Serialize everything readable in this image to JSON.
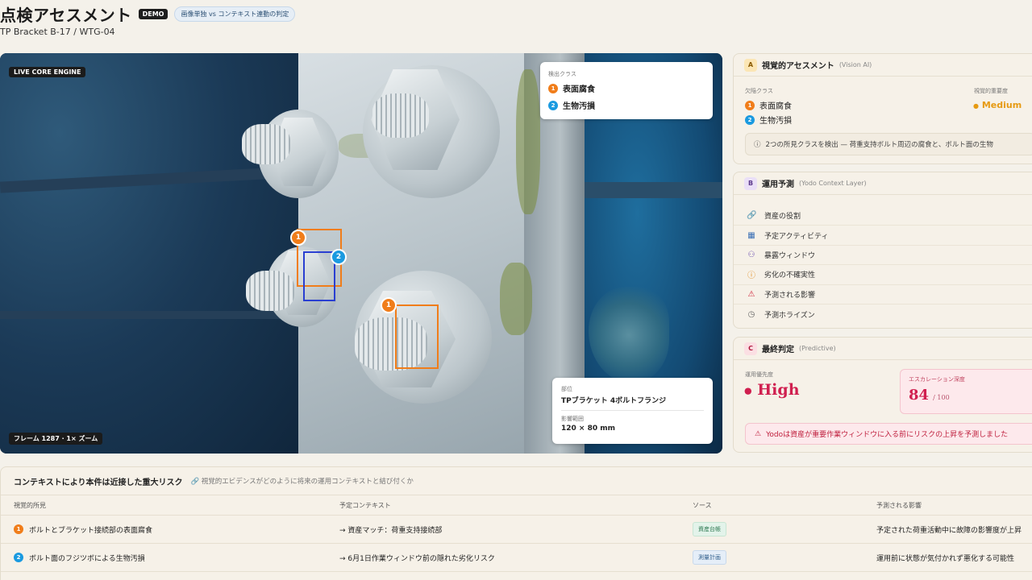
{
  "header": {
    "title": "点検アセスメント",
    "demo_badge": "DEMO",
    "mode_badge": "画像単独 vs コンテキスト連動の判定",
    "asset_path": "TP Bracket B-17 / WTG-04"
  },
  "image_panel": {
    "engine_tag": "LIVE CORE ENGINE",
    "frame_label": "フレーム 1287 · 1× ズーム",
    "detect_card": {
      "label": "検出クラス",
      "items": [
        {
          "num": "1",
          "label": "表面腐食"
        },
        {
          "num": "2",
          "label": "生物汚損"
        }
      ]
    },
    "info_card": {
      "part_label": "部位",
      "part_value": "TPブラケット 4ボルトフランジ",
      "range_label": "影響範囲",
      "range_value": "120 × 80 mm"
    },
    "markers": [
      "1",
      "2",
      "1"
    ]
  },
  "panel_a": {
    "letter": "A",
    "title": "視覚的アセスメント",
    "subtitle": "(Vision AI)",
    "defect_label": "欠陥クラス",
    "defects": [
      {
        "num": "1",
        "label": "表面腐食"
      },
      {
        "num": "2",
        "label": "生物汚損"
      }
    ],
    "severity_label": "視覚的重要度",
    "severity_value": "Medium",
    "note": "2つの所見クラスを検出 — 荷重支持ボルト周辺の腐食と、ボルト面の生物"
  },
  "panel_b": {
    "letter": "B",
    "title": "運用予測",
    "subtitle": "(Yodo Context Layer)",
    "rows": [
      {
        "icon": "link-icon",
        "glyph": "🔗",
        "label": "資産の役割"
      },
      {
        "icon": "calendar-icon",
        "glyph": "▦",
        "label": "予定アクティビティ"
      },
      {
        "icon": "people-icon",
        "glyph": "⚇",
        "label": "暴露ウィンドウ"
      },
      {
        "icon": "alert-circle-icon",
        "glyph": "ⓘ",
        "label": "劣化の不確実性"
      },
      {
        "icon": "warning-icon",
        "glyph": "⚠",
        "label": "予測される影響"
      },
      {
        "icon": "clock-icon",
        "glyph": "◷",
        "label": "予測ホライズン"
      }
    ]
  },
  "panel_c": {
    "letter": "C",
    "title": "最終判定",
    "subtitle": "(Predictive)",
    "priority_label": "運用優先度",
    "priority_value": "High",
    "escalation_label": "エスカレーション深度",
    "escalation_value": "84",
    "escalation_max": "/ 100",
    "alert": "Yodoは資産が重要作業ウィンドウに入る前にリスクの上昇を予測しました"
  },
  "table": {
    "title": "コンテキストにより本件は近接した重大リスク",
    "subtitle": "視覚的エビデンスがどのように将来の運用コンテキストと結び付くか",
    "columns": [
      "視覚的所見",
      "予定コンテキスト",
      "ソース",
      "予測される影響"
    ],
    "rows": [
      {
        "num": "1",
        "finding": "ボルトとブラケット接続部の表面腐食",
        "context": "→ 資産マッチ：荷重支持接続部",
        "source": "資産台帳",
        "impact": "予定された荷重活動中に故障の影響度が上昇"
      },
      {
        "num": "2",
        "finding": "ボルト面のフジツボによる生物汚損",
        "context": "→ 6月1日作業ウィンドウ前の隠れた劣化リスク",
        "source": "測量計画",
        "impact": "運用前に状態が気付かれず悪化する可能性"
      }
    ]
  },
  "colors": {
    "orange": "#f07d1a",
    "blue": "#1a9ae0",
    "medium": "#e69a12",
    "high": "#d01f4f"
  }
}
